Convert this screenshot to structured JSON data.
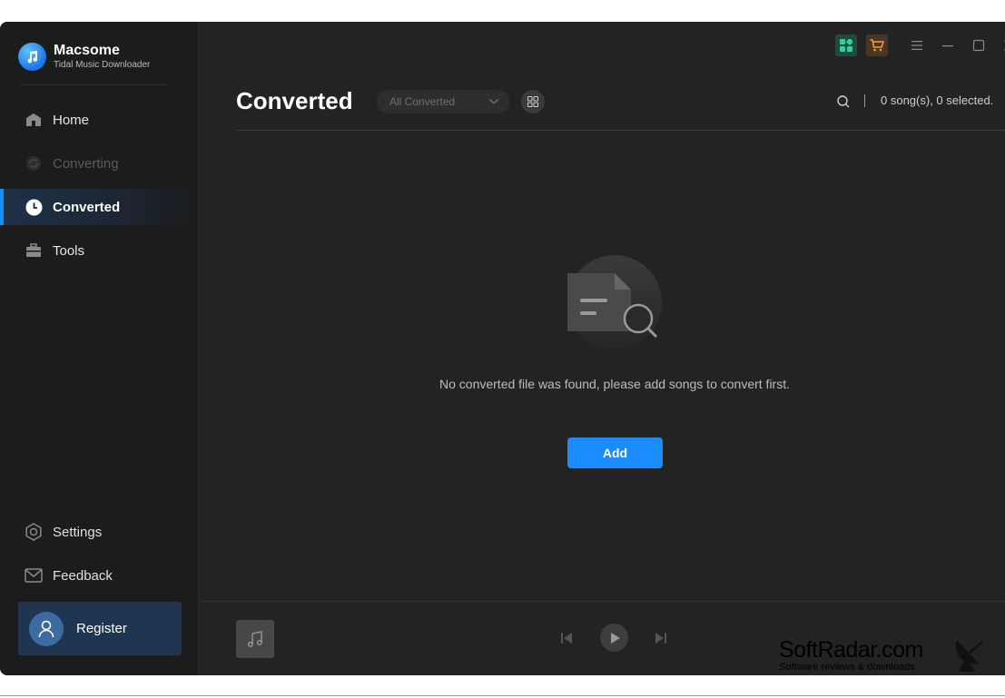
{
  "brand": {
    "title": "Macsome",
    "subtitle": "Tidal Music Downloader",
    "logo_color": "#1e73e8"
  },
  "sidebar": {
    "items": [
      {
        "label": "Home",
        "icon": "home-icon",
        "state": "normal"
      },
      {
        "label": "Converting",
        "icon": "converting-icon",
        "state": "disabled"
      },
      {
        "label": "Converted",
        "icon": "clock-icon",
        "state": "active"
      },
      {
        "label": "Tools",
        "icon": "toolbox-icon",
        "state": "normal"
      }
    ],
    "bottom_items": [
      {
        "label": "Settings",
        "icon": "gear-icon"
      },
      {
        "label": "Feedback",
        "icon": "mail-icon"
      }
    ],
    "register_label": "Register"
  },
  "header": {
    "title": "Converted",
    "filter_value": "All Converted",
    "count_text": "0 song(s), 0 selected."
  },
  "empty_state": {
    "message": "No converted file was found, please add songs to convert first.",
    "add_label": "Add"
  },
  "colors": {
    "accent": "#1a8cff",
    "background": "#232323",
    "sidebar": "#1c1c1c"
  },
  "watermark": {
    "title": "SoftRadar.com",
    "subtitle": "Software reviews & downloads"
  }
}
